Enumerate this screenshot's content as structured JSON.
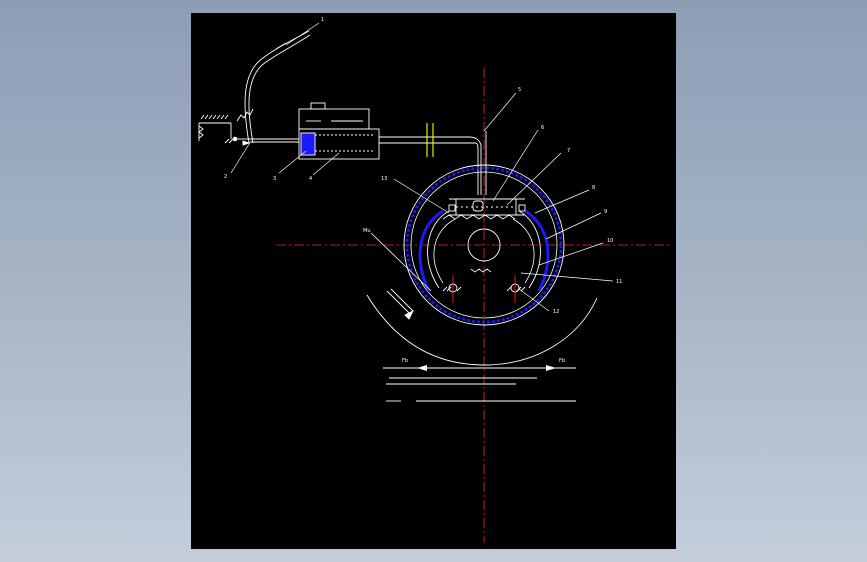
{
  "colors": {
    "background": "#000000",
    "outline": "#ffffff",
    "centerline": "#ff2020",
    "lining": "#1a1aff",
    "pipe_coupling": "#ffff00",
    "outer_frame": "#8d9db3"
  },
  "callouts": {
    "c1": "1",
    "c2": "2",
    "c3": "3",
    "c4": "4",
    "c5": "5",
    "c6": "6",
    "c7": "7",
    "c8": "8",
    "c9": "9",
    "c10": "10",
    "c11": "11",
    "c12": "12",
    "c13": "13"
  },
  "symbols": {
    "moment": "Mu",
    "force_left": "Fb",
    "force_right": "Fb"
  }
}
